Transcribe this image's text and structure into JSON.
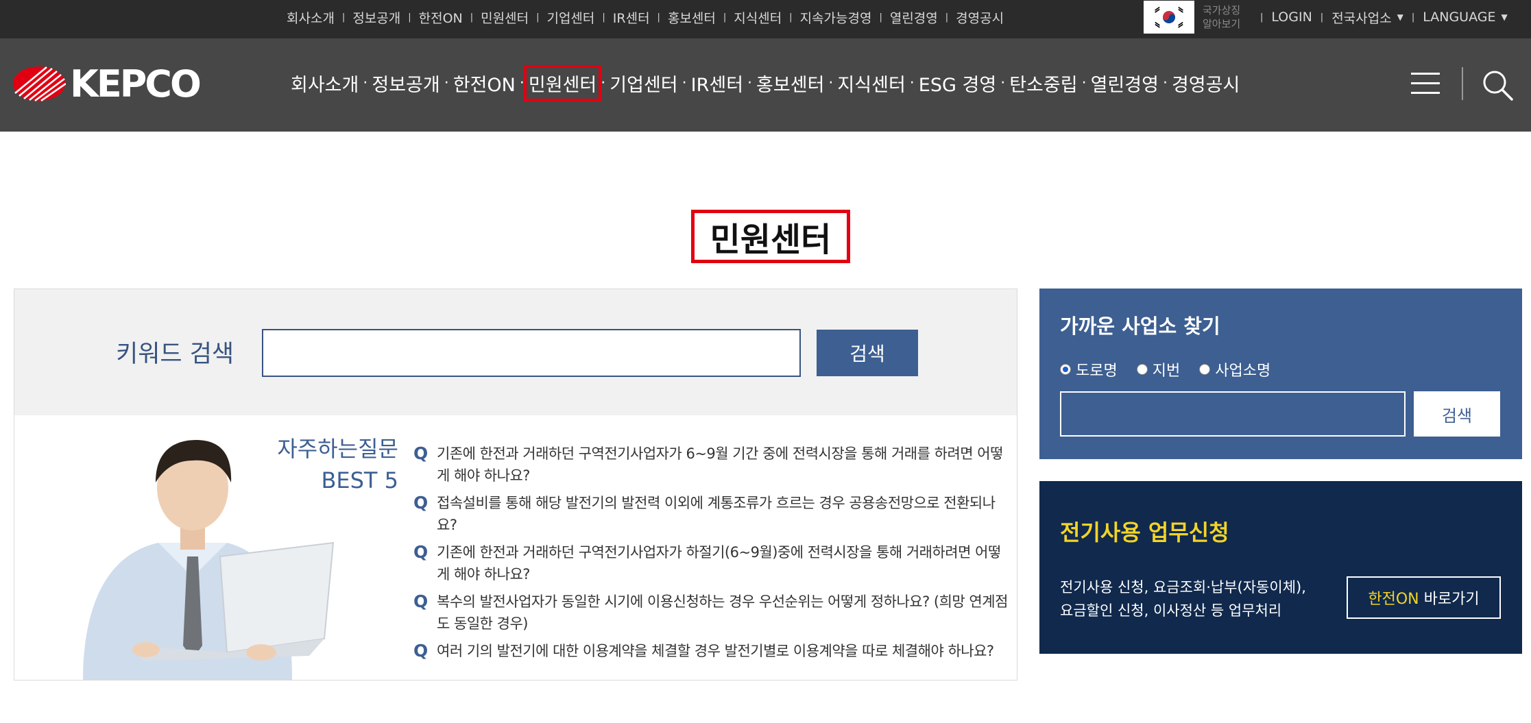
{
  "topnav": {
    "items": [
      "회사소개",
      "정보공개",
      "한전ON",
      "민원센터",
      "기업센터",
      "IR센터",
      "홍보센터",
      "지식센터",
      "지속가능경영",
      "열린경영",
      "경영공시"
    ]
  },
  "util": {
    "flag_text": "국가상징 알아보기",
    "login": "LOGIN",
    "offices": "전국사업소",
    "language": "LANGUAGE"
  },
  "logo": {
    "text": "KEPCO"
  },
  "mainnav": {
    "items": [
      "회사소개",
      "정보공개",
      "한전ON",
      "민원센터",
      "기업센터",
      "IR센터",
      "홍보센터",
      "지식센터",
      "ESG 경영",
      "탄소중립",
      "열린경영",
      "경영공시"
    ]
  },
  "page": {
    "title": "민원센터"
  },
  "keyword": {
    "label": "키워드 검색",
    "value": "",
    "button": "검색"
  },
  "faq": {
    "title_line1": "자주하는질문",
    "title_line2": "BEST 5",
    "marker": "Q",
    "items": [
      "기존에 한전과 거래하던 구역전기사업자가 6~9월 기간 중에 전력시장을 통해 거래를 하려면 어떻게 해야 하나요?",
      "접속설비를 통해 해당 발전기의 발전력 이외에 계통조류가 흐르는 경우 공용송전망으로 전환되나요?",
      "기존에 한전과 거래하던 구역전기사업자가 하절기(6~9월)중에 전력시장을 통해 거래하려면 어떻게 해야 하나요?",
      "복수의 발전사업자가 동일한 시기에 이용신청하는 경우 우선순위는 어떻게 정하나요? (희망 연계점도 동일한 경우)",
      "여러 기의 발전기에 대한 이용계약을 체결할 경우 발전기별로 이용계약을 따로 체결해야 하나요?"
    ]
  },
  "office": {
    "title": "가까운 사업소 찾기",
    "radios": [
      "도로명",
      "지번",
      "사업소명"
    ],
    "selected": "도로명",
    "input_value": "",
    "button": "검색"
  },
  "power": {
    "title": "전기사용 업무신청",
    "desc_line1": "전기사용 신청, 요금조회·납부(자동이체),",
    "desc_line2": "요금할인 신청, 이사정산 등 업무처리",
    "button_highlight": "한전ON",
    "button_rest": " 바로가기"
  },
  "colors": {
    "accent_red": "#e10012",
    "brand_blue": "#3d5f92",
    "navy": "#10294d",
    "yellow": "#f3d426"
  }
}
